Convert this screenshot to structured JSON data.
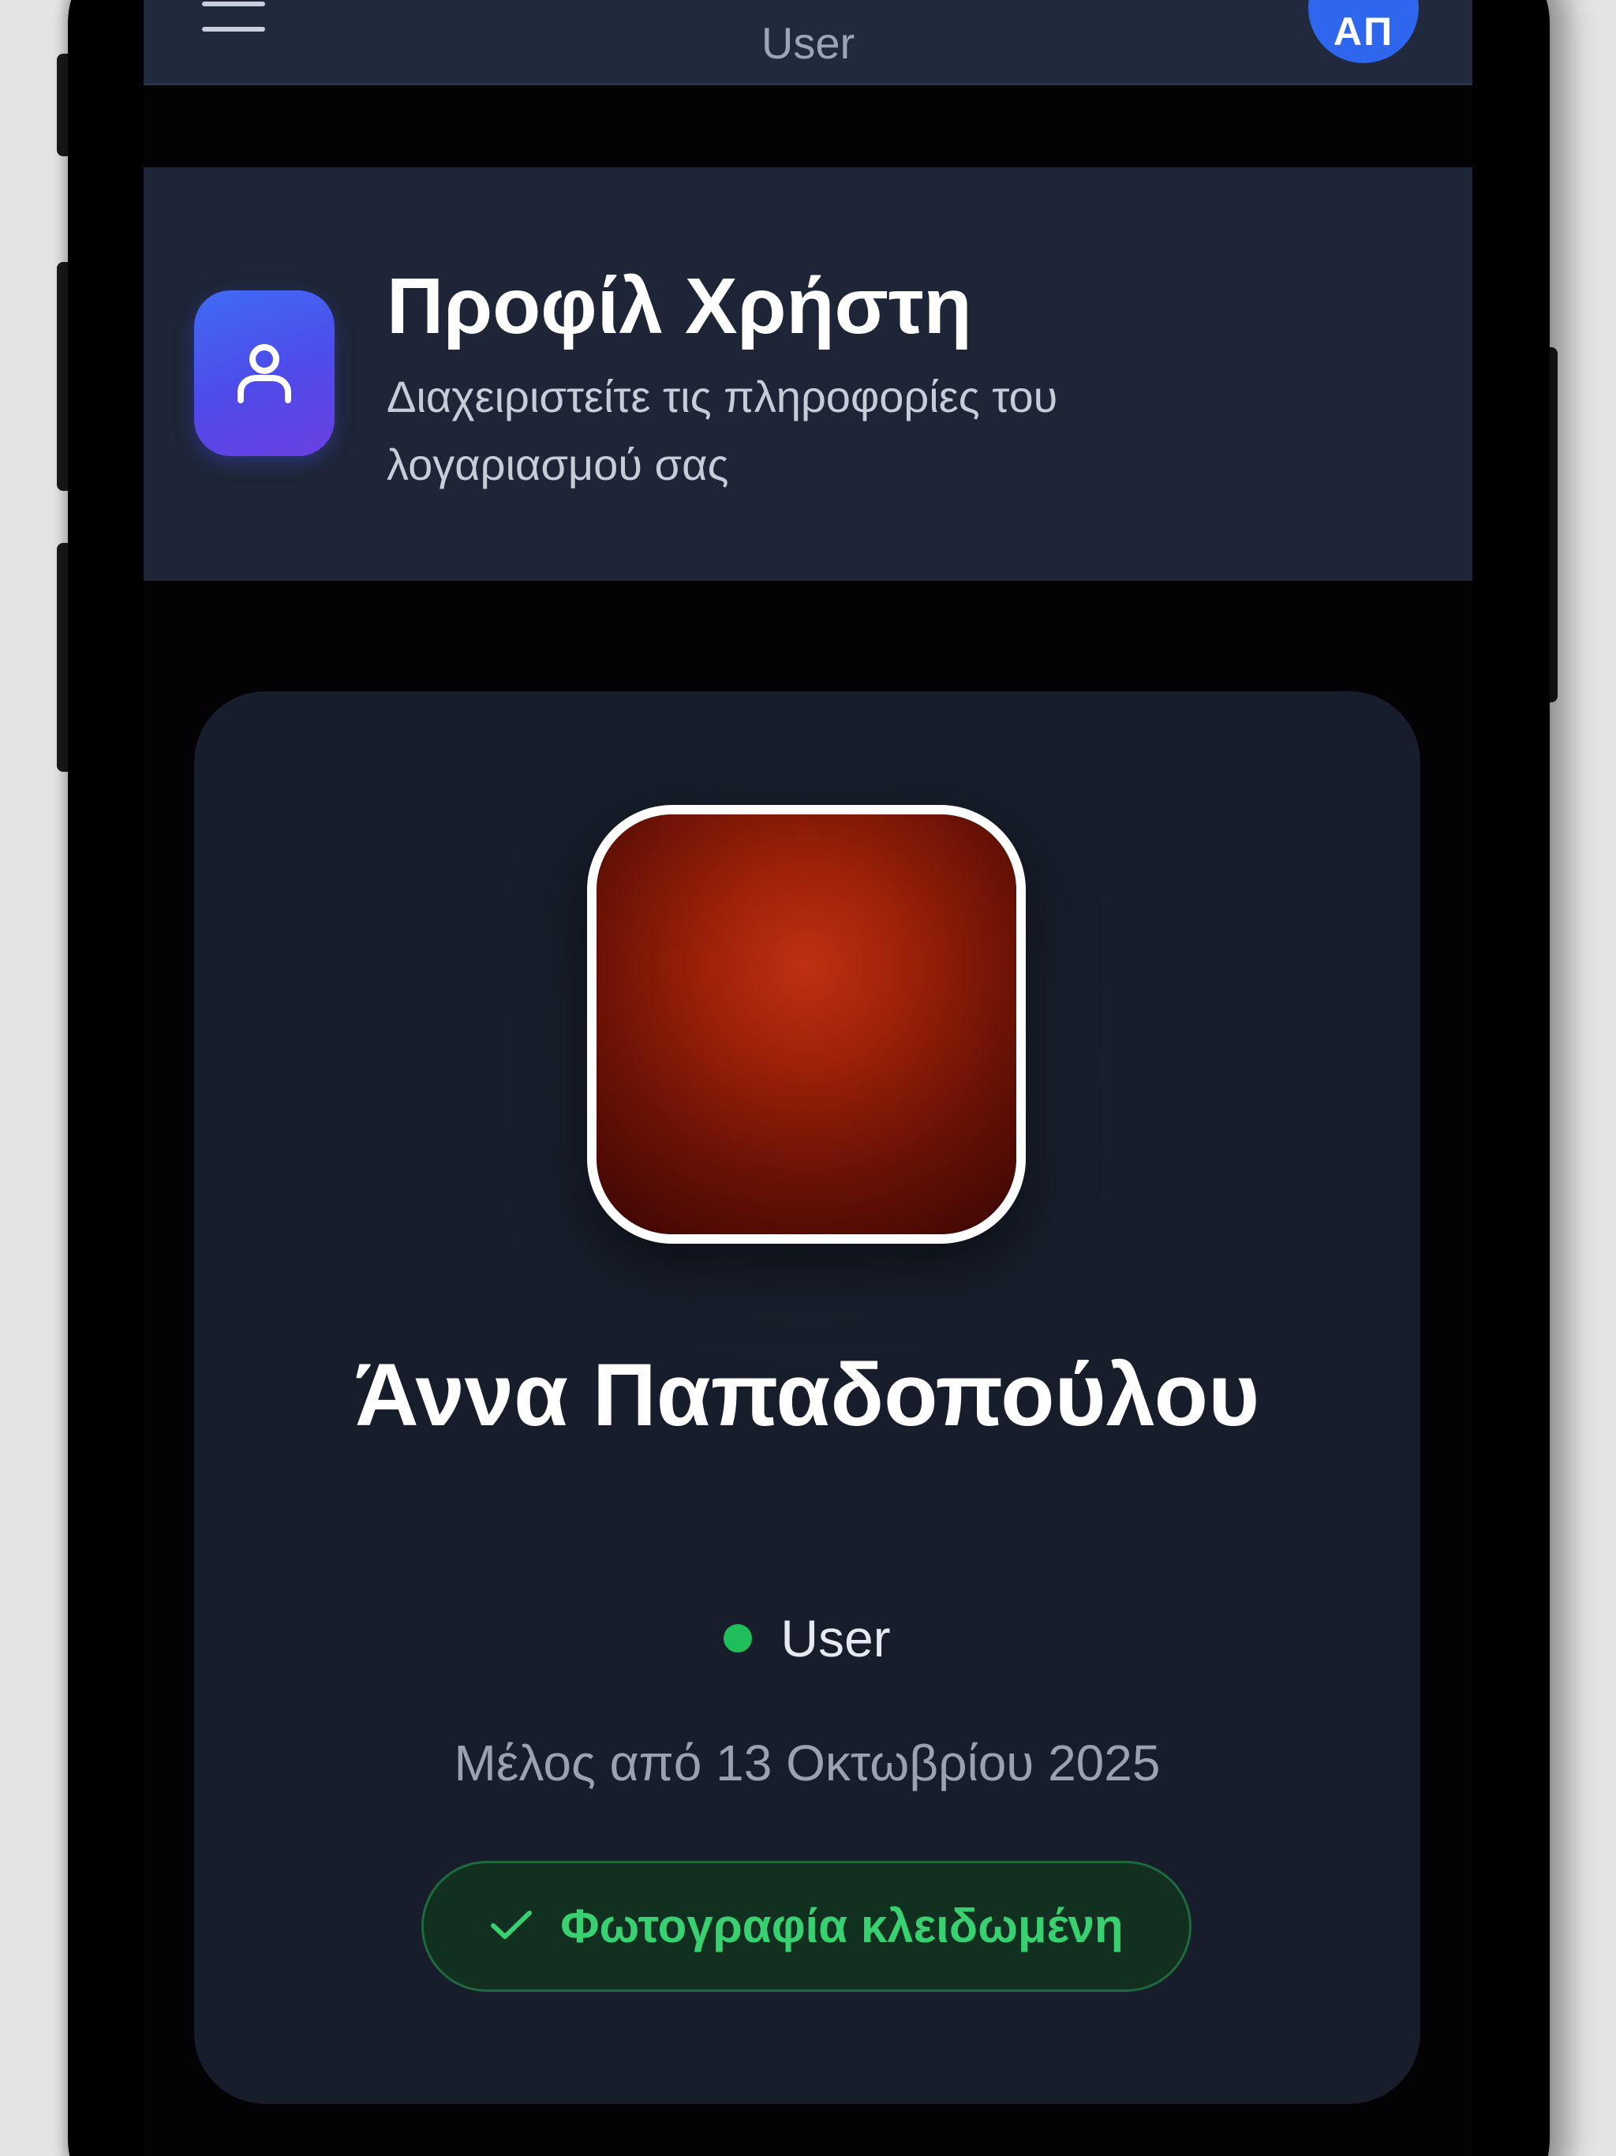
{
  "topbar": {
    "title": "User",
    "avatar_initials": "ΑΠ"
  },
  "header": {
    "title": "Προφίλ Χρήστη",
    "subtitle": "Διαχειριστείτε τις πληροφορίες του λογαριασμού σας",
    "icon": "user-icon"
  },
  "profile": {
    "name": "Άννα Παπαδοπούλου",
    "role": "User",
    "member_since": "Μέλος από 13 Οκτωβρίου 2025",
    "photo_status": "Φωτογραφία κλειδωμένη"
  },
  "colors": {
    "accent": "#2f66ee",
    "status_green": "#1fbe5a",
    "badge_text": "#39d071",
    "card_bg": "#171d2b",
    "header_bg": "#1d2536"
  }
}
